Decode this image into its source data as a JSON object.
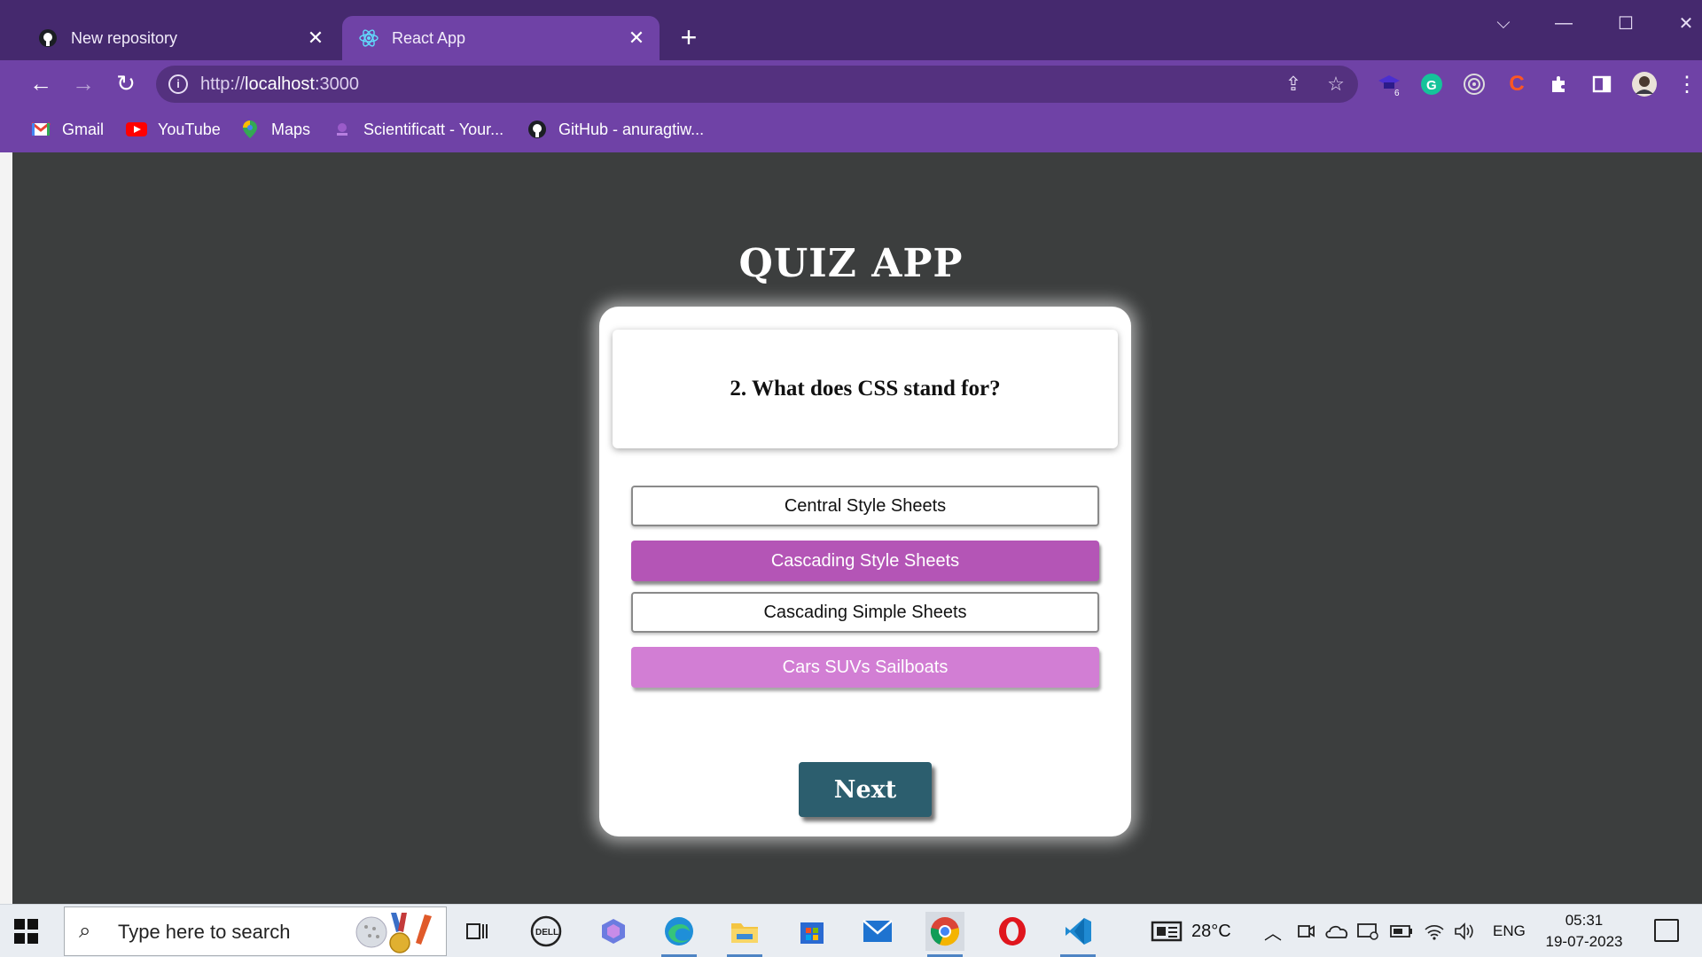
{
  "browser": {
    "tabs": [
      {
        "label": "New repository",
        "icon": "github-icon"
      },
      {
        "label": "React App",
        "icon": "react-icon"
      }
    ],
    "new_tab_label": "+",
    "address": {
      "scheme": "http://",
      "host": "localhost",
      "port": ":3000"
    },
    "bookmarks": [
      {
        "label": "Gmail",
        "icon": "gmail-icon"
      },
      {
        "label": "YouTube",
        "icon": "youtube-icon"
      },
      {
        "label": "Maps",
        "icon": "maps-icon"
      },
      {
        "label": "Scientificatt - Your...",
        "icon": "scientificatt-icon"
      },
      {
        "label": "GitHub - anuragtiw...",
        "icon": "github-icon"
      }
    ],
    "extension_badge": "6"
  },
  "quiz": {
    "title": "QUIZ APP",
    "question": "2. What does CSS stand for?",
    "options": [
      {
        "label": "Central Style Sheets",
        "state": "default"
      },
      {
        "label": "Cascading Style Sheets",
        "state": "selected"
      },
      {
        "label": "Cascading Simple Sheets",
        "state": "default"
      },
      {
        "label": "Cars SUVs Sailboats",
        "state": "highlighted"
      }
    ],
    "next_label": "Next"
  },
  "taskbar": {
    "search_placeholder": "Type here to search",
    "weather": "28°C",
    "language": "ENG",
    "time": "05:31",
    "date": "19-07-2023"
  },
  "colors": {
    "chrome_frame": "#6f42a6",
    "titlebar": "#45296e",
    "page_bg": "#3c3e3e",
    "option_selected": "#b455b6",
    "option_highlighted": "#d27ed4",
    "next_button": "#2c5e6e"
  }
}
